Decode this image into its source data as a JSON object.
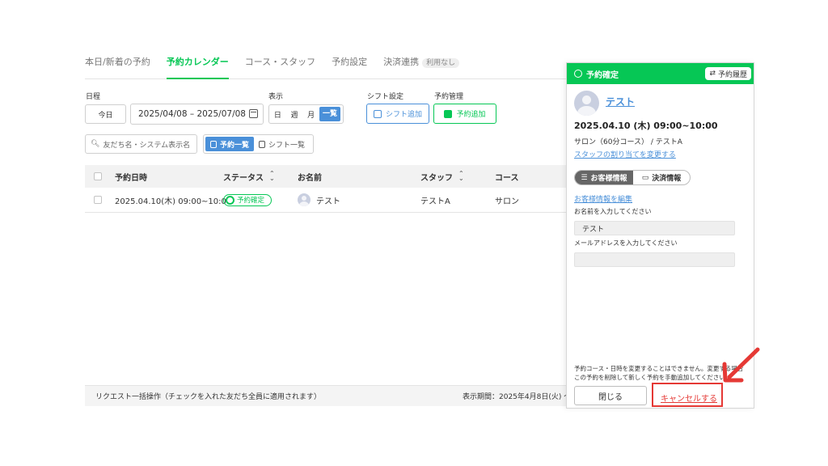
{
  "tabs": [
    {
      "label": "本日/新着の予約"
    },
    {
      "label": "予約カレンダー",
      "active": true
    },
    {
      "label": "コース・スタッフ"
    },
    {
      "label": "予約設定"
    },
    {
      "label": "決済連携",
      "badge": "利用なし"
    }
  ],
  "filters": {
    "schedule_label": "日程",
    "today_button": "今日",
    "date_range": "2025/04/08 – 2025/07/08",
    "display_label": "表示",
    "view_options": [
      "日",
      "週",
      "月",
      "一覧"
    ],
    "view_selected": "一覧",
    "shift_settings_label": "シフト設定",
    "add_shift_button": "シフト追加",
    "reservation_mgmt_label": "予約管理",
    "add_reservation_button": "予約追加",
    "search_placeholder": "友だち名・システム表示名",
    "list_toggle": {
      "reservations": "予約一覧",
      "shifts": "シフト一覧"
    }
  },
  "table": {
    "columns": {
      "datetime": "予約日時",
      "status": "ステータス",
      "name": "お名前",
      "staff": "スタッフ",
      "course": "コース"
    },
    "rows": [
      {
        "datetime": "2025.04.10(木) 09:00~10:00",
        "status": "予約確定",
        "name": "テスト",
        "staff": "テストA",
        "course": "サロン"
      }
    ]
  },
  "footer": {
    "bulk_text": "リクエスト一括操作（チェックを入れた友だち全員に適用されます）",
    "period_text": "表示期間：2025年4月8日(火) 〜"
  },
  "panel": {
    "header_title": "予約確定",
    "history_button": "予約履歴",
    "customer_name": "テスト",
    "datetime": "2025.04.10 (木) 09:00~10:00",
    "course_line": "サロン（60分コース） / テストA",
    "change_staff_link": "スタッフの割り当てを変更する",
    "tabs": {
      "customer": "お客様情報",
      "payment": "決済情報"
    },
    "edit_link": "お客様情報を編集",
    "name_label": "お名前を入力してください",
    "name_value": "テスト",
    "email_label": "メールアドレスを入力してください",
    "email_value": "",
    "note_line1": "予約コース・日時を変更することはできません。変更する場合",
    "note_line2": "この予約を削除して新しく予約を手動追加してください。",
    "close_button": "閉じる",
    "cancel_link": "キャンセルする"
  },
  "colors": {
    "brand_green": "#06c755",
    "accent_blue": "#4a90d9",
    "annotation_red": "#e53935"
  }
}
